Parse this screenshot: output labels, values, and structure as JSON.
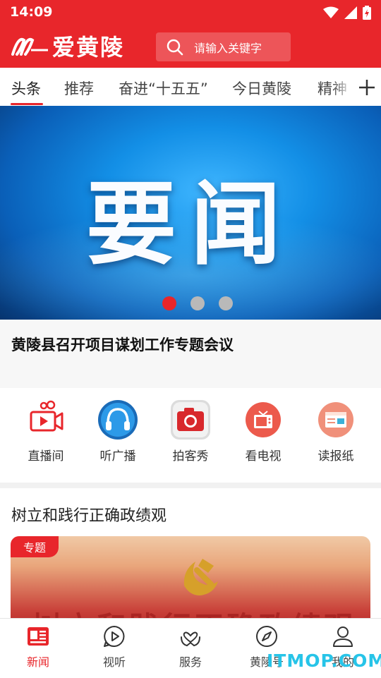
{
  "status_bar": {
    "time": "14:09"
  },
  "app": {
    "logo_text": "爱黄陵"
  },
  "search": {
    "placeholder": "请输入关键字"
  },
  "tabs": [
    {
      "label": "头条",
      "active": true
    },
    {
      "label": "推荐",
      "active": false
    },
    {
      "label": "奋进“十五五”",
      "active": false
    },
    {
      "label": "今日黄陵",
      "active": false
    },
    {
      "label": "精神",
      "active": false
    }
  ],
  "banner": {
    "image_text": "要闻",
    "slide_count": 3,
    "active_slide": 1,
    "headline": "黄陵县召开项目谋划工作专题会议"
  },
  "quick_entries": [
    {
      "label": "直播间",
      "icon": "live-camera-icon"
    },
    {
      "label": "听广播",
      "icon": "headphones-icon"
    },
    {
      "label": "拍客秀",
      "icon": "camera-icon"
    },
    {
      "label": "看电视",
      "icon": "tv-icon"
    },
    {
      "label": "读报纸",
      "icon": "newspaper-icon"
    }
  ],
  "topic": {
    "title": "树立和践行正确政绩观",
    "badge": "专题",
    "image_text": "树立和践行正确政绩观"
  },
  "bottom_nav": [
    {
      "label": "新闻",
      "icon": "news-icon",
      "active": true
    },
    {
      "label": "视听",
      "icon": "play-icon",
      "active": false
    },
    {
      "label": "服务",
      "icon": "service-heart-icon",
      "active": false
    },
    {
      "label": "黄陵号",
      "icon": "compass-icon",
      "active": false
    },
    {
      "label": "我的",
      "icon": "user-icon",
      "active": false
    }
  ],
  "watermark": "ITMOP.COM",
  "colors": {
    "brand_red": "#e8262b",
    "banner_blue": "#138fe6",
    "watermark_cyan": "#27c4e8"
  }
}
